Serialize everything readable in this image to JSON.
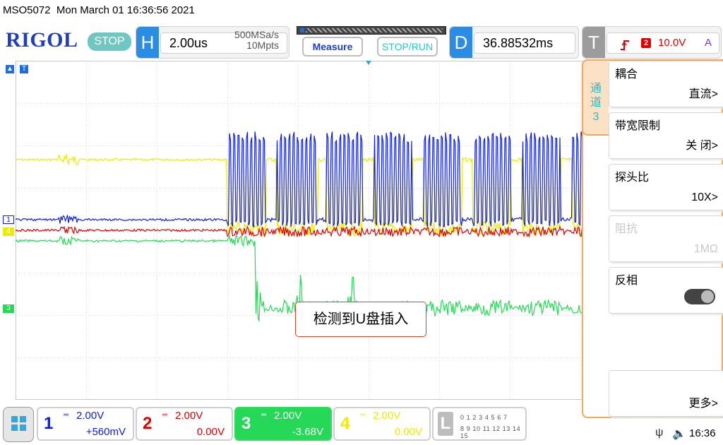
{
  "status": {
    "model": "MSO5072",
    "datetime": "Mon March 01 16:36:56 2021"
  },
  "header": {
    "logo": "RIGOL",
    "run_state": "STOP",
    "horizontal": {
      "letter": "H",
      "timebase": "2.00us",
      "sample_rate": "500MSa/s",
      "memory_depth": "10Mpts"
    },
    "measure_label": "Measure",
    "stoprun_label": "STOP/RUN",
    "delay": {
      "letter": "D",
      "value": "36.88532ms"
    },
    "trigger": {
      "letter": "T",
      "source": "2",
      "level": "10.0V",
      "mode": "A",
      "edge_icon": "rising-edge-icon"
    }
  },
  "colors": {
    "ch1": "#1020d0",
    "ch2": "#e00000",
    "ch3": "#26d857",
    "ch4": "#ecec00",
    "menu_border": "#f5a85b",
    "accent": "#2a8de3"
  },
  "annotation": "检测到U盘插入",
  "channel_markers": {
    "ch1": "1",
    "ch4": "4",
    "ch3": "3"
  },
  "menu": {
    "tab": [
      "通",
      "道",
      "3"
    ],
    "items": [
      {
        "title": "耦合",
        "value": "直流"
      },
      {
        "title": "带宽限制",
        "value": "关 闭"
      },
      {
        "title": "探头比",
        "value": "10X"
      },
      {
        "title": "阻抗",
        "value": "1MΩ"
      },
      {
        "title": "反相",
        "value": ""
      },
      {
        "title": "",
        "value": ""
      },
      {
        "title": "",
        "value": "更多"
      }
    ]
  },
  "channels": [
    {
      "num": "1",
      "scale": "2.00V",
      "offset": "+560mV"
    },
    {
      "num": "2",
      "scale": "2.00V",
      "offset": "0.00V"
    },
    {
      "num": "3",
      "scale": "2.00V",
      "offset": "-3.68V"
    },
    {
      "num": "4",
      "scale": "2.00V",
      "offset": "0.00V"
    }
  ],
  "logic": {
    "label": "L",
    "row1": "0 1 2 3   4 5 6 7",
    "row2": "8 9 10 11 12 13 14 15"
  },
  "clock": "16:36"
}
